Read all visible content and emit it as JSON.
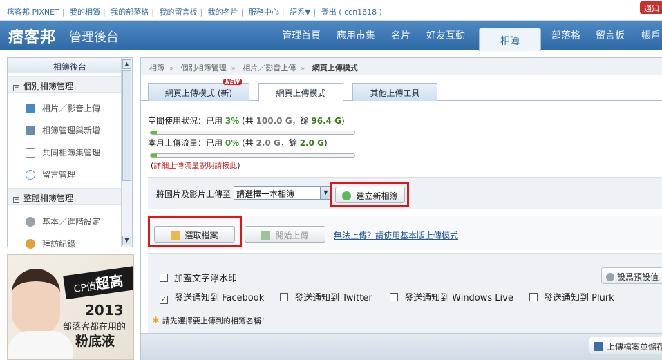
{
  "topbar": {
    "links": [
      "痞客邦 PIXNET",
      "我的相簿",
      "我的部落格",
      "我的留言板",
      "我的名片",
      "服務中心",
      "語系▼",
      "登出 ( ccn1618 )"
    ],
    "notify_label": "通知"
  },
  "header": {
    "logo": "痞客邦",
    "title": "管理後台",
    "nav": [
      "管理首頁",
      "應用市集",
      "名片",
      "好友互動",
      "相簿",
      "部落格",
      "留言板",
      "帳戶"
    ],
    "active_nav": "相簿"
  },
  "sidebar": {
    "title": "相簿後台",
    "groups": [
      {
        "label": "個別相簿管理",
        "items": [
          "相片／影音上傳",
          "相簿管理與新增",
          "共同相簿集管理",
          "留言管理"
        ]
      },
      {
        "label": "整體相簿管理",
        "items": [
          "基本／進階設定",
          "拜訪紀錄"
        ]
      }
    ]
  },
  "ad": {
    "cp_prefix": "CP值",
    "cp_highlight": "超高",
    "year": "2013",
    "line1": "部落客都在用的",
    "line2": "粉底液"
  },
  "breadcrumb": [
    "相簿",
    "個別相簿管理",
    "相片／影音上傳",
    "網頁上傳模式"
  ],
  "upload_tabs": [
    {
      "label": "網頁上傳模式 (新)",
      "badge": "NEW"
    },
    {
      "label": "網頁上傳模式"
    },
    {
      "label": "其他上傳工具"
    }
  ],
  "active_upload_tab": "網頁上傳模式",
  "quota": {
    "space": {
      "prefix": "空間使用狀況：已用",
      "pct": "3%",
      "total_prefix": "(共",
      "total": "100.0 G",
      "left_prefix": "，餘",
      "left": "96.4 G",
      "suffix": ")",
      "used_fraction": 0.03
    },
    "month": {
      "prefix": "本月上傳流量：已用",
      "pct": "0%",
      "total_prefix": "(共",
      "total": "2.0 G",
      "left_prefix": "，餘",
      "left": "2.0 G",
      "suffix": ")",
      "used_fraction": 0.0
    },
    "detail_open": "(",
    "detail_link": "詳細上傳流量說明請按此",
    "detail_close": ")"
  },
  "album": {
    "label": "將圖片及影片上傳至",
    "selected": "請選擇一本相簿",
    "create_button": "建立新相簿"
  },
  "upload_actions": {
    "select_files": "選取檔案",
    "start_upload": "開始上傳",
    "basic_mode_link": "無法上傳？請使用基本版上傳模式"
  },
  "options": {
    "watermark": "加蓋文字浮水印",
    "facebook": "發送通知到 Facebook",
    "twitter": "發送通知到 Twitter",
    "windows_live": "發送通知到 Windows Live",
    "plurk": "發送通知到 Plurk",
    "default_button": "設爲預設值"
  },
  "hint": "請先選擇要上傳到的相簿名稱！",
  "save_button": "上傳檔案並儲存"
}
